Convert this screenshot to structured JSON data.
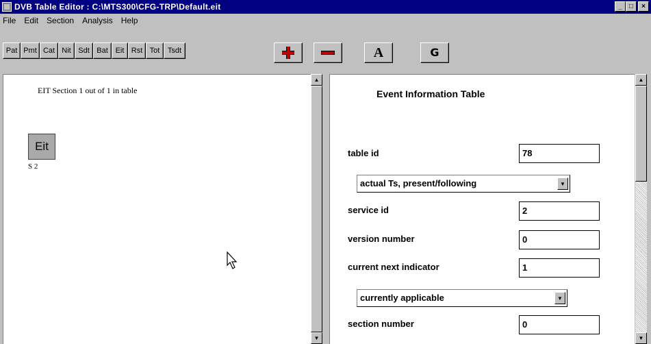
{
  "window": {
    "title": "DVB Table Editor : C:\\MTS300\\CFG-TRP\\Default.eit",
    "controls": {
      "minimize": "_",
      "maximize": "□",
      "close": "×"
    }
  },
  "menu": [
    {
      "label": "File"
    },
    {
      "label": "Edit"
    },
    {
      "label": "Section"
    },
    {
      "label": "Analysis"
    },
    {
      "label": "Help"
    }
  ],
  "toolbar": {
    "tables": [
      "Pat",
      "Pmt",
      "Cat",
      "Nit",
      "Sdt",
      "Bat",
      "Eit",
      "Rst",
      "Tot",
      "Tsdt"
    ],
    "add_icon": "plus-icon",
    "remove_icon": "minus-icon",
    "a_label": "A",
    "g_label": "G"
  },
  "left_pane": {
    "section_info": "EIT Section 1 out of 1 in table",
    "node_label": "Eit",
    "node_sub": "S 2"
  },
  "right_pane": {
    "title": "Event Information Table",
    "table_id_label": "table id",
    "table_id_value": "78",
    "table_type_option": "actual Ts, present/following",
    "service_id_label": "service id",
    "service_id_value": "2",
    "version_number_label": "version number",
    "version_number_value": "0",
    "current_next_label": "current next indicator",
    "current_next_value": "1",
    "applicability_option": "currently applicable",
    "section_number_label": "section number",
    "section_number_value": "0"
  },
  "colors": {
    "titlebar": "#000080",
    "face": "#c0c0c0",
    "node_fill": "#a9a9a9",
    "icon_red": "#c00000"
  }
}
